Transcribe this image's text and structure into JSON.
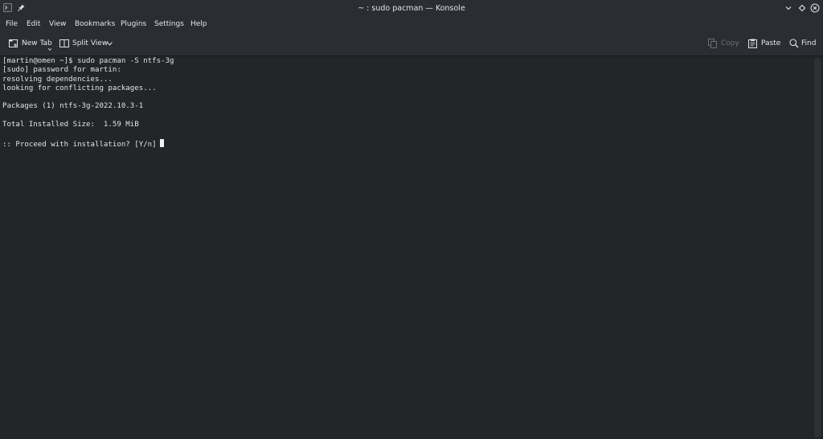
{
  "window": {
    "title": "~ : sudo pacman — Konsole"
  },
  "menu": {
    "items": [
      "File",
      "Edit",
      "View",
      "Bookmarks",
      "Plugins",
      "Settings",
      "Help"
    ]
  },
  "toolbar": {
    "new_tab_label": "New Tab",
    "split_view_label": "Split View",
    "copy_label": "Copy",
    "paste_label": "Paste",
    "find_label": "Find"
  },
  "terminal": {
    "lines": [
      "[martin@omen ~]$ sudo pacman -S ntfs-3g",
      "[sudo] password for martin:",
      "resolving dependencies...",
      "looking for conflicting packages...",
      "",
      "Packages (1) ntfs-3g-2022.10.3-1",
      "",
      "Total Installed Size:  1.59 MiB",
      "",
      ":: Proceed with installation? [Y/n]"
    ]
  },
  "colors": {
    "background": "#232629",
    "chrome": "#2a2e32",
    "text": "#e0e3e6"
  }
}
